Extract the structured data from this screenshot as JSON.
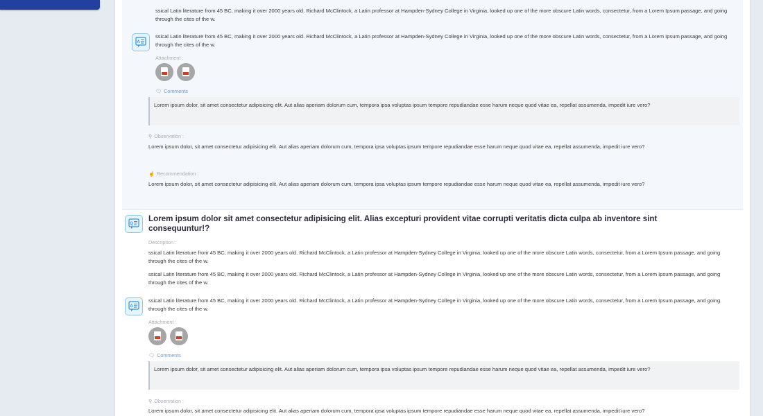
{
  "sections": [
    {
      "intro_text": "ssical Latin literature from 45 BC, making it over 2000 years old. Richard McClintock, a Latin professor at Hampden-Sydney College in Virginia, looked up one of the more obscure Latin words, consectetur, from a Lorem Ipsum passage, and going through the cites of the w.",
      "answer_text": "ssical Latin literature from 45 BC, making it over 2000 years old. Richard McClintock, a Latin professor at Hampden-Sydney College in Virginia, looked up one of the more obscure Latin words, consectetur, from a Lorem Ipsum passage, and going through the cites of the w.",
      "attachment_label": "Attachment :",
      "comments_label": "Comments",
      "comment_text": "Lorem ipsum dolor, sit amet consectetur adipisicing elit. Aut alias aperiam dolorum cum, tempora ipsa voluptas ipsum tempore repudiandae esse harum neque quod vitae ea, repellat assumenda, impedit iure vero?",
      "observation_label": "Observation :",
      "observation_text": "Lorem ipsum dolor, sit amet consectetur adipisicing elit. Aut alias aperiam dolorum cum, tempora ipsa voluptas ipsum tempore repudiandae esse harum neque quod vitae ea, repellat assumenda, impedit iure vero?",
      "recommendation_label": "Recommendation :",
      "recommendation_text": "Lorem ipsum dolor, sit amet consectetur adipisicing elit. Aut alias aperiam dolorum cum, tempora ipsa voluptas ipsum tempore repudiandae esse harum neque quod vitae ea, repellat assumenda, impedit iure vero?"
    },
    {
      "question_title": "Lorem ipsum dolor sit amet consectetur adipisicing elit. Alias excepturi provident vitae corrupti veritatis dicta culpa ab inventore sint consequuntur!?",
      "description_label": "Description :",
      "description_text_1": "ssical Latin literature from 45 BC, making it over 2000 years old. Richard McClintock, a Latin professor at Hampden-Sydney College in Virginia, looked up one of the more obscure Latin words, consectetur, from a Lorem Ipsum passage, and going through the cites of the w.",
      "description_text_2": "ssical Latin literature from 45 BC, making it over 2000 years old. Richard McClintock, a Latin professor at Hampden-Sydney College in Virginia, looked up one of the more obscure Latin words, consectetur, from a Lorem Ipsum passage, and going through the cites of the w.",
      "answer_text": "ssical Latin literature from 45 BC, making it over 2000 years old. Richard McClintock, a Latin professor at Hampden-Sydney College in Virginia, looked up one of the more obscure Latin words, consectetur, from a Lorem Ipsum passage, and going through the cites of the w.",
      "attachment_label": "Attachment :",
      "comments_label": "Comments",
      "comment_text": "Lorem ipsum dolor, sit amet consectetur adipisicing elit. Aut alias aperiam dolorum cum, tempora ipsa voluptas ipsum tempore repudiandae esse harum neque quod vitae ea, repellat assumenda, impedit iure vero?",
      "observation_label": "Observation :",
      "observation_text": "Lorem ipsum dolor, sit amet consectetur adipisicing elit. Aut alias aperiam dolorum cum, tempora ipsa voluptas ipsum tempore repudiandae esse harum neque quod vitae ea, repellat assumenda, impedit iure vero?"
    }
  ],
  "icons": {
    "answer": "answer-icon",
    "question": "question-icon",
    "attachment": "pdf-icon",
    "comments": "comments-icon",
    "observation": "search-icon",
    "recommendation": "thumbs-up-icon"
  },
  "colors": {
    "sidebar_button": "#24409f",
    "icon_border": "#8ec7e6",
    "icon_fill": "#e6f4fb",
    "pdf_red": "#d23a2a"
  }
}
